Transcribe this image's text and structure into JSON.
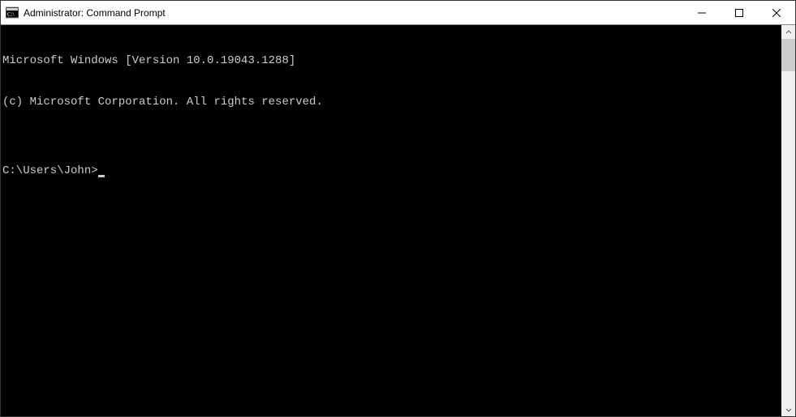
{
  "window": {
    "title": "Administrator: Command Prompt"
  },
  "terminal": {
    "line1": "Microsoft Windows [Version 10.0.19043.1288]",
    "line2": "(c) Microsoft Corporation. All rights reserved.",
    "blank": "",
    "prompt": "C:\\Users\\John>"
  }
}
